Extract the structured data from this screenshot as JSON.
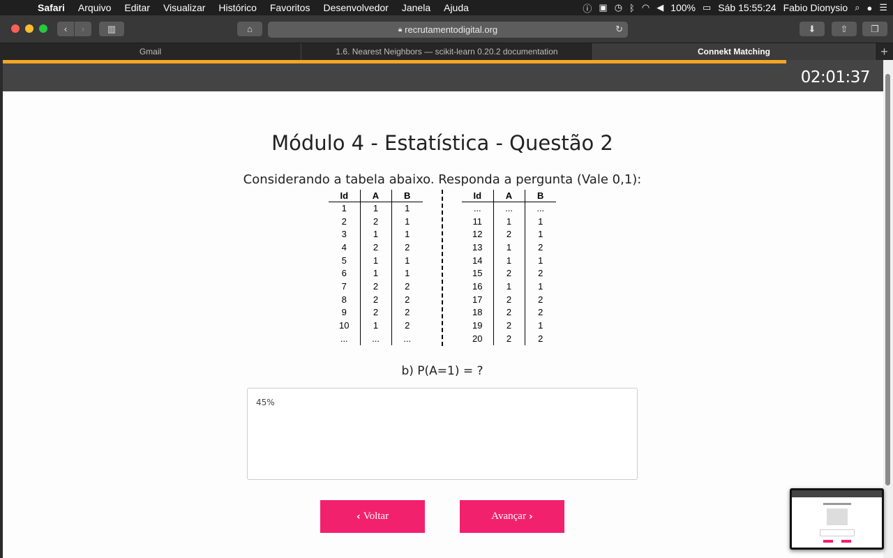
{
  "menubar": {
    "items": [
      "Safari",
      "Arquivo",
      "Editar",
      "Visualizar",
      "Histórico",
      "Favoritos",
      "Desenvolvedor",
      "Janela",
      "Ajuda"
    ],
    "battery": "100%",
    "datetime": "Sáb 15:55:24",
    "user": "Fabio Dionysio"
  },
  "toolbar": {
    "url": "recrutamentodigital.org"
  },
  "tabs": [
    {
      "label": "Gmail"
    },
    {
      "label": "1.6. Nearest Neighbors — scikit-learn 0.20.2 documentation"
    },
    {
      "label": "Connekt Matching"
    }
  ],
  "page": {
    "progress_fraction": 0.89,
    "timer": "02:01:37",
    "title": "Módulo 4 - Estatística - Questão 2",
    "instruction": "Considerando a tabela abaixo. Responda a pergunta (Vale 0,1):",
    "question": "b) P(A=1) = ?",
    "answer_value": "45%",
    "back_label": "Voltar",
    "next_label": "Avançar"
  },
  "table": {
    "headers": [
      "Id",
      "A",
      "B"
    ],
    "left_rows": [
      [
        "1",
        "1",
        "1"
      ],
      [
        "2",
        "2",
        "1"
      ],
      [
        "3",
        "1",
        "1"
      ],
      [
        "4",
        "2",
        "2"
      ],
      [
        "5",
        "1",
        "1"
      ],
      [
        "6",
        "1",
        "1"
      ],
      [
        "7",
        "2",
        "2"
      ],
      [
        "8",
        "2",
        "2"
      ],
      [
        "9",
        "2",
        "2"
      ],
      [
        "10",
        "1",
        "2"
      ],
      [
        "...",
        "...",
        "..."
      ]
    ],
    "right_rows": [
      [
        "...",
        "...",
        "..."
      ],
      [
        "11",
        "1",
        "1"
      ],
      [
        "12",
        "2",
        "1"
      ],
      [
        "13",
        "1",
        "2"
      ],
      [
        "14",
        "1",
        "1"
      ],
      [
        "15",
        "2",
        "2"
      ],
      [
        "16",
        "1",
        "1"
      ],
      [
        "17",
        "2",
        "2"
      ],
      [
        "18",
        "2",
        "2"
      ],
      [
        "19",
        "2",
        "1"
      ],
      [
        "20",
        "2",
        "2"
      ]
    ]
  }
}
